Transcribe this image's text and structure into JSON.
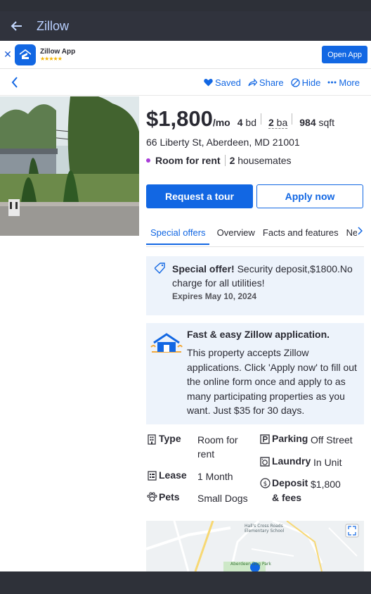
{
  "app_bar": {
    "title": "Zillow"
  },
  "banner": {
    "app_name": "Zillow App",
    "stars": "★★★★★",
    "open_label": "Open App"
  },
  "actions": {
    "saved": "Saved",
    "share": "Share",
    "hide": "Hide",
    "more": "More"
  },
  "listing": {
    "price": "$1,800",
    "per": "/mo",
    "beds_num": "4",
    "beds_unit": "bd",
    "baths_num": "2",
    "baths_unit": "ba",
    "sqft_num": "984",
    "sqft_unit": "sqft",
    "address": "66 Liberty St, Aberdeen, MD 21001",
    "room_type": "Room for rent",
    "housemates_num": "2",
    "housemates_label": "housemates"
  },
  "buttons": {
    "tour": "Request a tour",
    "apply": "Apply now"
  },
  "tabs": [
    "Special offers",
    "Overview",
    "Facts and features",
    "Ne"
  ],
  "offer": {
    "title": "Special offer!",
    "text": "Security deposit,$1800.No charge for all utilities!",
    "expires": "Expires May 10, 2024"
  },
  "application": {
    "title": "Fast & easy Zillow application.",
    "body": "This property accepts Zillow applications. Click 'Apply now' to fill out the online form once and apply to as many participating properties as you want. Just $35 for 30 days."
  },
  "facts": {
    "type_label": "Type",
    "type_value": "Room for rent",
    "lease_label": "Lease",
    "lease_value": "1 Month",
    "pets_label": "Pets",
    "pets_value": "Small Dogs",
    "parking_label": "Parking",
    "parking_value": "Off Street",
    "laundry_label": "Laundry",
    "laundry_value": "In Unit",
    "deposit_label": "Deposit",
    "deposit_value": "$1,800",
    "deposit_label2": "& fees"
  },
  "map": {
    "school": "Hall's Cross Roads Elementary School",
    "park": "Aberdeen Dog Park"
  },
  "colors": {
    "accent": "#1267e3",
    "app_bar": "#30333d",
    "card_bg": "#edf3fb",
    "dot": "#a83cd8"
  }
}
